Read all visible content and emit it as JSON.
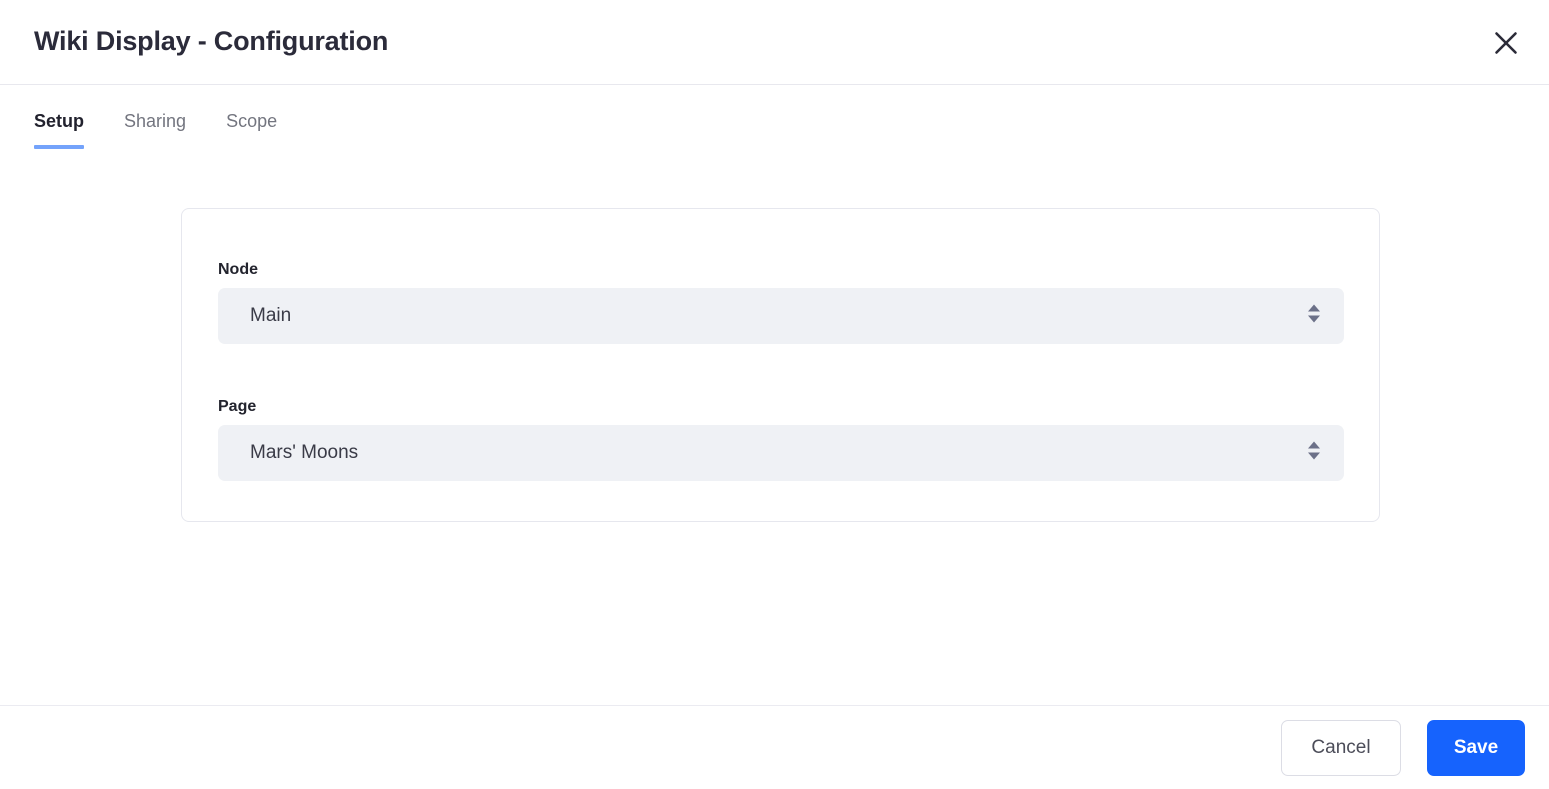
{
  "dialog": {
    "title": "Wiki Display - Configuration",
    "close_icon": "close-icon"
  },
  "tabs": [
    {
      "id": "setup",
      "label": "Setup",
      "active": true
    },
    {
      "id": "sharing",
      "label": "Sharing",
      "active": false
    },
    {
      "id": "scope",
      "label": "Scope",
      "active": false
    }
  ],
  "form": {
    "fields": [
      {
        "id": "node",
        "label": "Node",
        "value": "Main",
        "icon": "stepper-arrows-icon"
      },
      {
        "id": "page",
        "label": "Page",
        "value": "Mars' Moons",
        "icon": "stepper-arrows-icon"
      }
    ]
  },
  "footer": {
    "cancel_label": "Cancel",
    "save_label": "Save"
  },
  "colors": {
    "accent_blue": "#1663fd",
    "tab_underline": "#74a3fb",
    "field_background": "#eff1f5",
    "title_text": "#2b2b3a",
    "muted_text": "#73757f",
    "card_border": "#e6e7ee"
  }
}
